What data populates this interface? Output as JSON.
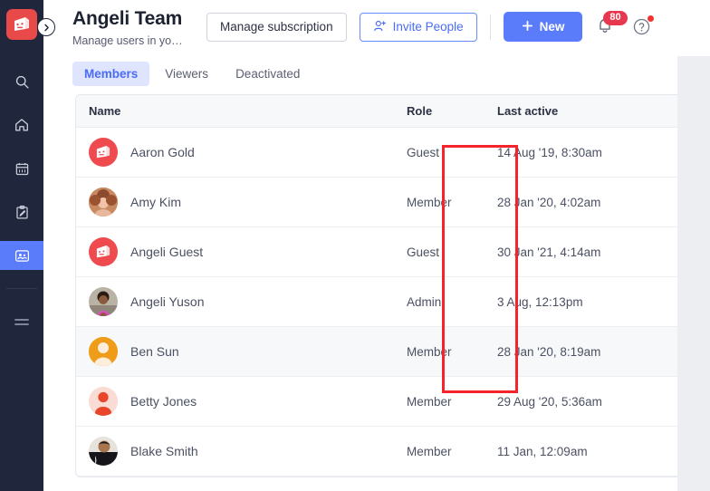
{
  "sidebar": {
    "logo_name": "app-logo",
    "toggle_name": "expand-sidebar-toggle",
    "items": [
      {
        "id": "search",
        "icon": "search-icon",
        "label": "Search",
        "active": false
      },
      {
        "id": "home",
        "icon": "home-icon",
        "label": "Home",
        "active": false
      },
      {
        "id": "calendar",
        "icon": "calendar-icon",
        "label": "Calendar",
        "active": false
      },
      {
        "id": "notes",
        "icon": "notes-icon",
        "label": "Notes",
        "active": false
      },
      {
        "id": "people",
        "icon": "people-icon",
        "label": "People",
        "active": true
      }
    ],
    "menu_label": "Menu"
  },
  "header": {
    "title": "Angeli Team",
    "subtitle": "Manage users in yo…",
    "manage_subscription_label": "Manage subscription",
    "invite_people_label": "Invite People",
    "invite_icon": "user-plus-icon",
    "new_label": "New",
    "new_icon": "plus-icon",
    "bell_icon": "bell-icon",
    "notification_count": "80",
    "help_icon": "question-circle-icon",
    "accent_blue": "#5b7cfa",
    "badge_red": "#e8384f"
  },
  "tabs": [
    {
      "label": "Members",
      "active": true
    },
    {
      "label": "Viewers",
      "active": false
    },
    {
      "label": "Deactivated",
      "active": false
    }
  ],
  "table": {
    "columns": [
      "Name",
      "Role",
      "Last active"
    ],
    "rows": [
      {
        "name": "Aaron Gold",
        "role": "Guest",
        "last_active": "14 Aug '19, 8:30am",
        "avatar": "logo-red",
        "highlight": false
      },
      {
        "name": "Amy Kim",
        "role": "Member",
        "last_active": "28 Jan '20, 4:02am",
        "avatar": "photo-woman1",
        "highlight": false
      },
      {
        "name": "Angeli Guest",
        "role": "Guest",
        "last_active": "30 Jan '21, 4:14am",
        "avatar": "logo-red",
        "highlight": false
      },
      {
        "name": "Angeli Yuson",
        "role": "Admin",
        "last_active": "3 Aug, 12:13pm",
        "avatar": "photo-woman2",
        "highlight": false
      },
      {
        "name": "Ben Sun",
        "role": "Member",
        "last_active": "28 Jan '20, 8:19am",
        "avatar": "avatar-orange",
        "highlight": true
      },
      {
        "name": "Betty Jones",
        "role": "Member",
        "last_active": "29 Aug '20, 5:36am",
        "avatar": "avatar-red",
        "highlight": false
      },
      {
        "name": "Blake Smith",
        "role": "Member",
        "last_active": "11 Jan, 12:09am",
        "avatar": "photo-man1",
        "highlight": false
      }
    ]
  },
  "annotation": {
    "name": "role-column-highlight",
    "color": "#f5242a"
  }
}
